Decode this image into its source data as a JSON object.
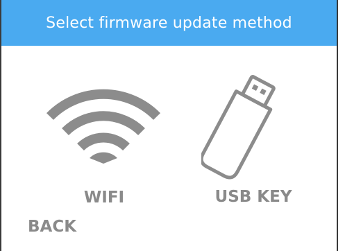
{
  "header": {
    "title": "Select firmware update method",
    "color": "#4aaaf0"
  },
  "options": [
    {
      "label": "WIFI",
      "icon": "wifi-icon"
    },
    {
      "label": "USB KEY",
      "icon": "usb-key-icon"
    }
  ],
  "back": {
    "label": "BACK"
  },
  "colors": {
    "icon_gray": "#8c8c8c",
    "label_gray": "#8a8a8a",
    "header_text": "#ffffff"
  }
}
